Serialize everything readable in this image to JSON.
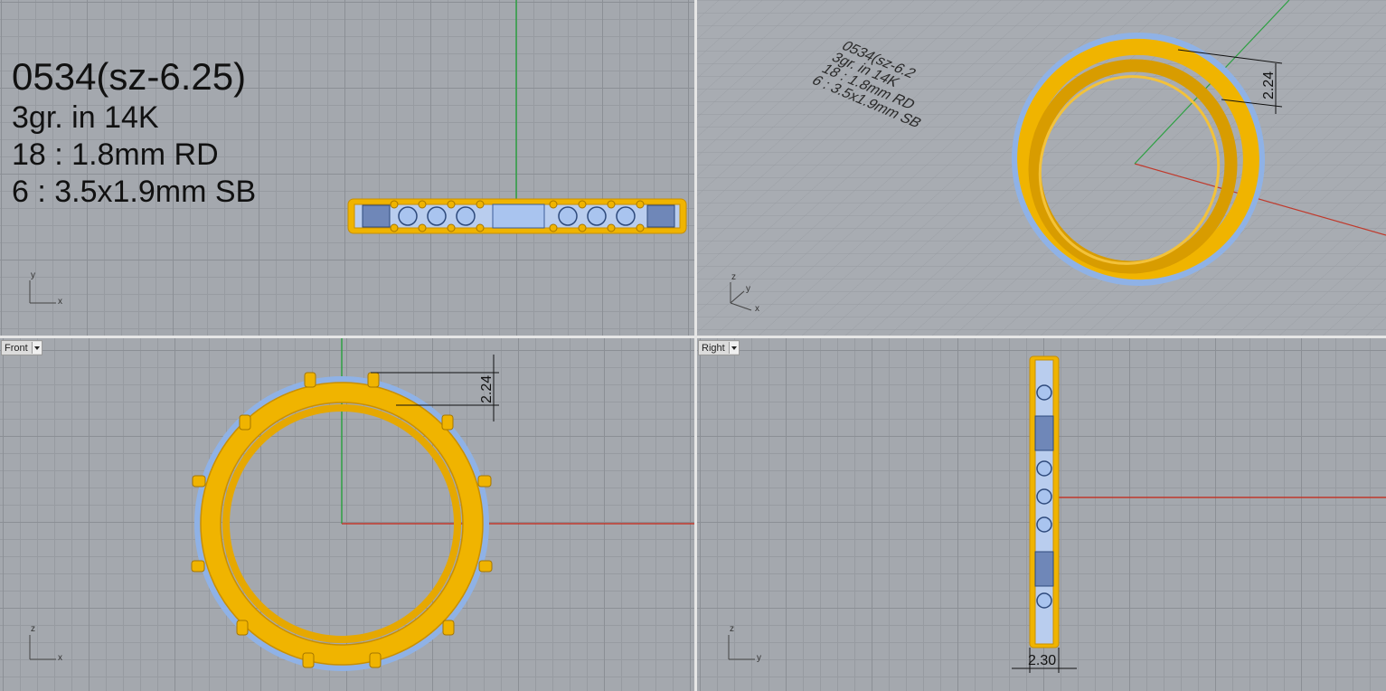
{
  "notes": {
    "title": "0534(sz-6.25)",
    "weight": "3gr.  in 14K",
    "round_stones": "18 : 1.8mm RD",
    "baguettes": "6 : 3.5x1.9mm SB"
  },
  "perspective_notes": {
    "title": "0534(sz-6.2",
    "weight": "3gr.  in 14K",
    "round_stones": "18 : 1.8mm RD",
    "baguettes": "6 : 3.5x1.9mm SB"
  },
  "viewports": {
    "front_label": "Front",
    "right_label": "Right"
  },
  "dimensions": {
    "front_height": "2.24",
    "persp_height": "2.24",
    "right_width": "2.30"
  },
  "axes": {
    "top": [
      "y",
      "x"
    ],
    "persp": [
      "z",
      "y",
      "x"
    ],
    "front": [
      "z",
      "x"
    ],
    "right": [
      "z",
      "y"
    ]
  },
  "colors": {
    "gold": "#f0b400",
    "gold_dark": "#c98f00",
    "stone": "#a9c4ef",
    "grid_bg": "#a4a8ae",
    "x_axis": "#c0392b",
    "y_axis": "#2ea043"
  }
}
